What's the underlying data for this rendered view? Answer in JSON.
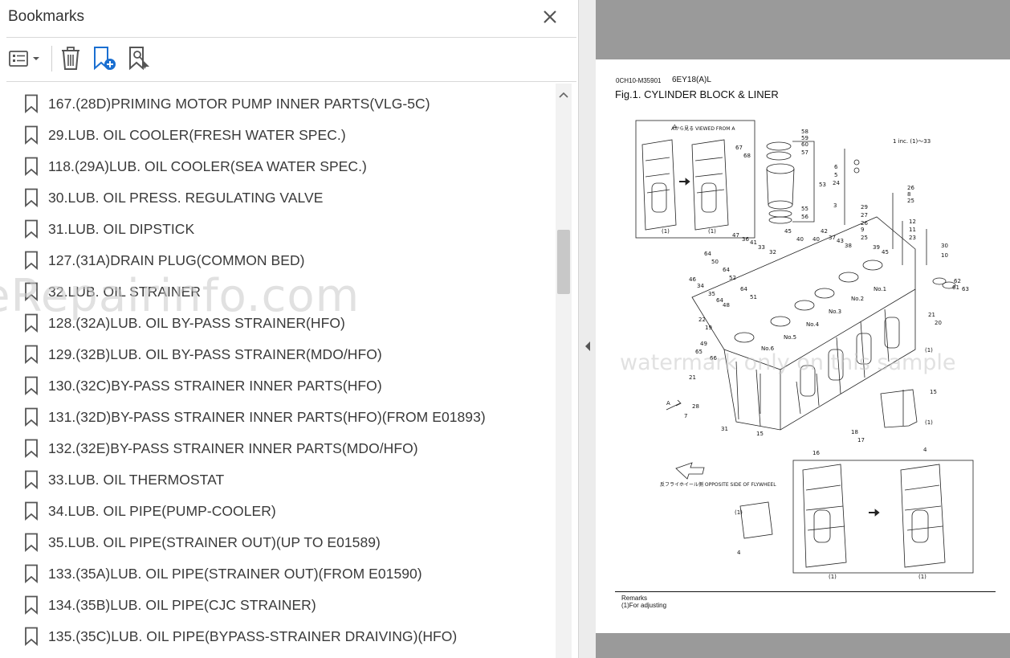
{
  "panel": {
    "title": "Bookmarks",
    "close_icon": "close-icon",
    "toolbar": {
      "options_icon": "list-options-icon",
      "delete_icon": "trash-icon",
      "add_icon": "add-bookmark-icon",
      "find_icon": "find-bookmark-icon"
    }
  },
  "bookmarks": [
    "167.(28D)PRIMING MOTOR PUMP INNER PARTS(VLG-5C)",
    "29.LUB. OIL COOLER(FRESH WATER SPEC.)",
    "118.(29A)LUB. OIL COOLER(SEA WATER SPEC.)",
    "30.LUB. OIL PRESS. REGULATING VALVE",
    "31.LUB. OIL DIPSTICK",
    "127.(31A)DRAIN PLUG(COMMON BED)",
    "32.LUB. OIL STRAINER",
    "128.(32A)LUB. OIL BY-PASS STRAINER(HFO)",
    "129.(32B)LUB. OIL BY-PASS STRAINER(MDO/HFO)",
    "130.(32C)BY-PASS STRAINER INNER PARTS(HFO)",
    "131.(32D)BY-PASS STRAINER INNER PARTS(HFO)(FROM E01893)",
    "132.(32E)BY-PASS STRAINER INNER PARTS(MDO/HFO)",
    "33.LUB. OIL THERMOSTAT",
    "34.LUB. OIL PIPE(PUMP-COOLER)",
    "35.LUB. OIL PIPE(STRAINER OUT)(UP TO E01589)",
    "133.(35A)LUB. OIL PIPE(STRAINER OUT)(FROM E01590)",
    "134.(35B)LUB. OIL PIPE(CJC STRAINER)",
    "135.(35C)LUB. OIL PIPE(BYPASS-STRAINER DRAIVING)(HFO)"
  ],
  "document": {
    "code": "0CH10-M35901",
    "model": "6EY18(A)L",
    "figure_title": "Fig.1.  CYLINDER BLOCK & LINER",
    "viewed_from": "Aから見る VIEWED FROM A",
    "note": "1 inc. (1)～33",
    "opposite_side": "反フライホイール側 OPPOSITE SIDE OF FLYWHEEL",
    "remarks_title": "Remarks",
    "remarks_text": "(1)For adjusting",
    "watermark1": "eRepairinfo.com",
    "watermark2": "watermark only on this sample"
  }
}
